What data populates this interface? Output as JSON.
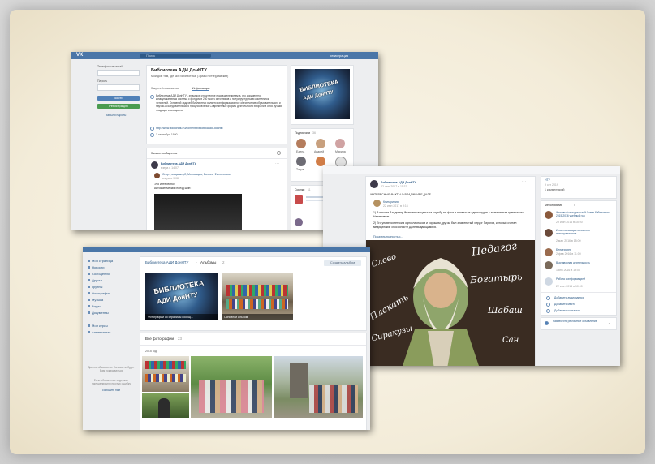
{
  "shot1": {
    "logo": "VK",
    "search_placeholder": "Поиск",
    "register_link": "регистрация",
    "login": {
      "phone_label": "Телефон или email",
      "password_label": "Пароль",
      "login_button": "Войти",
      "register_button": "Регистрация",
      "forgot_link": "Забыли пароль?"
    },
    "group": {
      "title": "Библиотека АДИ ДонНТУ",
      "subtitle": "Мой дом там, где моя библиотека. (Эразм Роттердамский)",
      "tab_pinned": "Закреплённая запись",
      "tab_info": "Информация",
      "description": "Библиотека АДИ ДонНТУ - значимое структурное подразделение вуза, его документно-коммуникативная система с фондом в 250 тысяч источников и полуструктурными комплектом читателей. Основной задачей библиотеки является информационное обеспечение образовательного и научно-исследовательского процессов вуза. Современные формы деятельности вобрали в себя лучшие традиции имеющиеся.",
      "site_link": "http://www.adidonntu.ru/content/biblioteka-adi-donntu",
      "date": "1 сентября 1990",
      "wall_title": "Записи сообщества",
      "post_author": "Библиотека АДИ ДонНТУ",
      "post_date": "вчера в 14:07",
      "post_sub_author": "Спорт, медиаклуб, Мотивация, Бизнес, Философия",
      "post_sub_date": "вчера в 9:08",
      "post_text1": "Это интересно!",
      "post_text2": "Автоматический поезд шин:",
      "avatar_caption_line1": "БИБЛИОТЕКА",
      "avatar_caption_line2": "АДИ ДонНТУ",
      "subscribers_label": "Подписчики",
      "subscribers_count": "36",
      "subscriber_names": [
        "Елена",
        "Андрей",
        "Марина",
        "Татра",
        "",
        ""
      ],
      "links_label": "Ссылки",
      "links_count": "11"
    }
  },
  "shot2": {
    "post_author": "Библиотека АДИ ДонНТУ",
    "post_date": "22 июн 2017 в 11:37",
    "post_heading": "ИНТЕРЕСНЫЕ ФАКТЫ О ВЛАДИМИРЕ ДАЛЕ",
    "sub_author": "Книгариния",
    "sub_date": "22 июн 2017 в 9:16",
    "fact1": "1) В юности Владимир Иванович вступил на службу на флот и плавал на одном судне с знаменитым адмиралом Нахимовым.",
    "fact2": "2) Его университетским однокласником и хорошим другом был знаменитый хирург Пирогов, который считал медицинские способности Дале выдающимися.",
    "show_more": "Показать полностью...",
    "top_right_line1": "НТУ",
    "top_right_line2": "9 окт 2019",
    "top_right_line3": "1 комментарий",
    "events_label": "Мероприятия",
    "events_count": "6",
    "events": [
      {
        "title": "Итоговый методический Совет библиотеки. 2015-2016 учебный год",
        "date": "29 июн 2016 в 15:00"
      },
      {
        "title": "Инвентаризация основного книгохранилища",
        "date": "2 мар 2016 в 15:00"
      },
      {
        "title": "Бенкерсинг",
        "date": "2 фев 2016 в 11:00"
      },
      {
        "title": "Выставочная деятельность",
        "date": "1 янв 2016 в 19:00"
      },
      {
        "title": "Работа с информацией",
        "date": "22 июн 2015 в 10:00"
      }
    ],
    "add_audio": "Добавить аудиозапись",
    "add_place": "Добавить место",
    "add_contacts": "Добавить контакты",
    "ad_button": "Разместить рекламное объявление",
    "illustration_words": [
      "Педагог",
      "Богатырь",
      "Шабаш",
      "Слово",
      "Сиракузы",
      "Плакать",
      "Сан"
    ]
  },
  "shot3": {
    "menu": [
      "Моя страница",
      "Новости",
      "Сообщения",
      "Друзья",
      "Группы",
      "Фотографии",
      "Музыка",
      "Видео",
      "Документы"
    ],
    "menu_extra": [
      "Мои курсы",
      "Антиплагиат"
    ],
    "ad_note1": "Данное объявление больше не будет Вам показываться",
    "ad_note2": "Если объявление содержит нарушения или прочую ошибку",
    "ad_note_link": "сообщите нам",
    "breadcrumb_group": "Библиотека АДИ ДонНТУ",
    "breadcrumb_sep": "›",
    "breadcrumb_albums": "Альбомы",
    "albums_count": "2",
    "create_album_button": "Создать альбом",
    "album1_caption": "Фотографии со страницы сообщ...",
    "album1_count": "2",
    "album2_caption": "Основной альбом",
    "album2_count": "2",
    "all_photos_label": "Все фотографии",
    "all_photos_count": "23",
    "year_label": "2015 год"
  },
  "colors": {
    "vk_blue": "#4a76a8",
    "vk_link": "#2a5885",
    "bg_cream": "#f3ecd9"
  }
}
